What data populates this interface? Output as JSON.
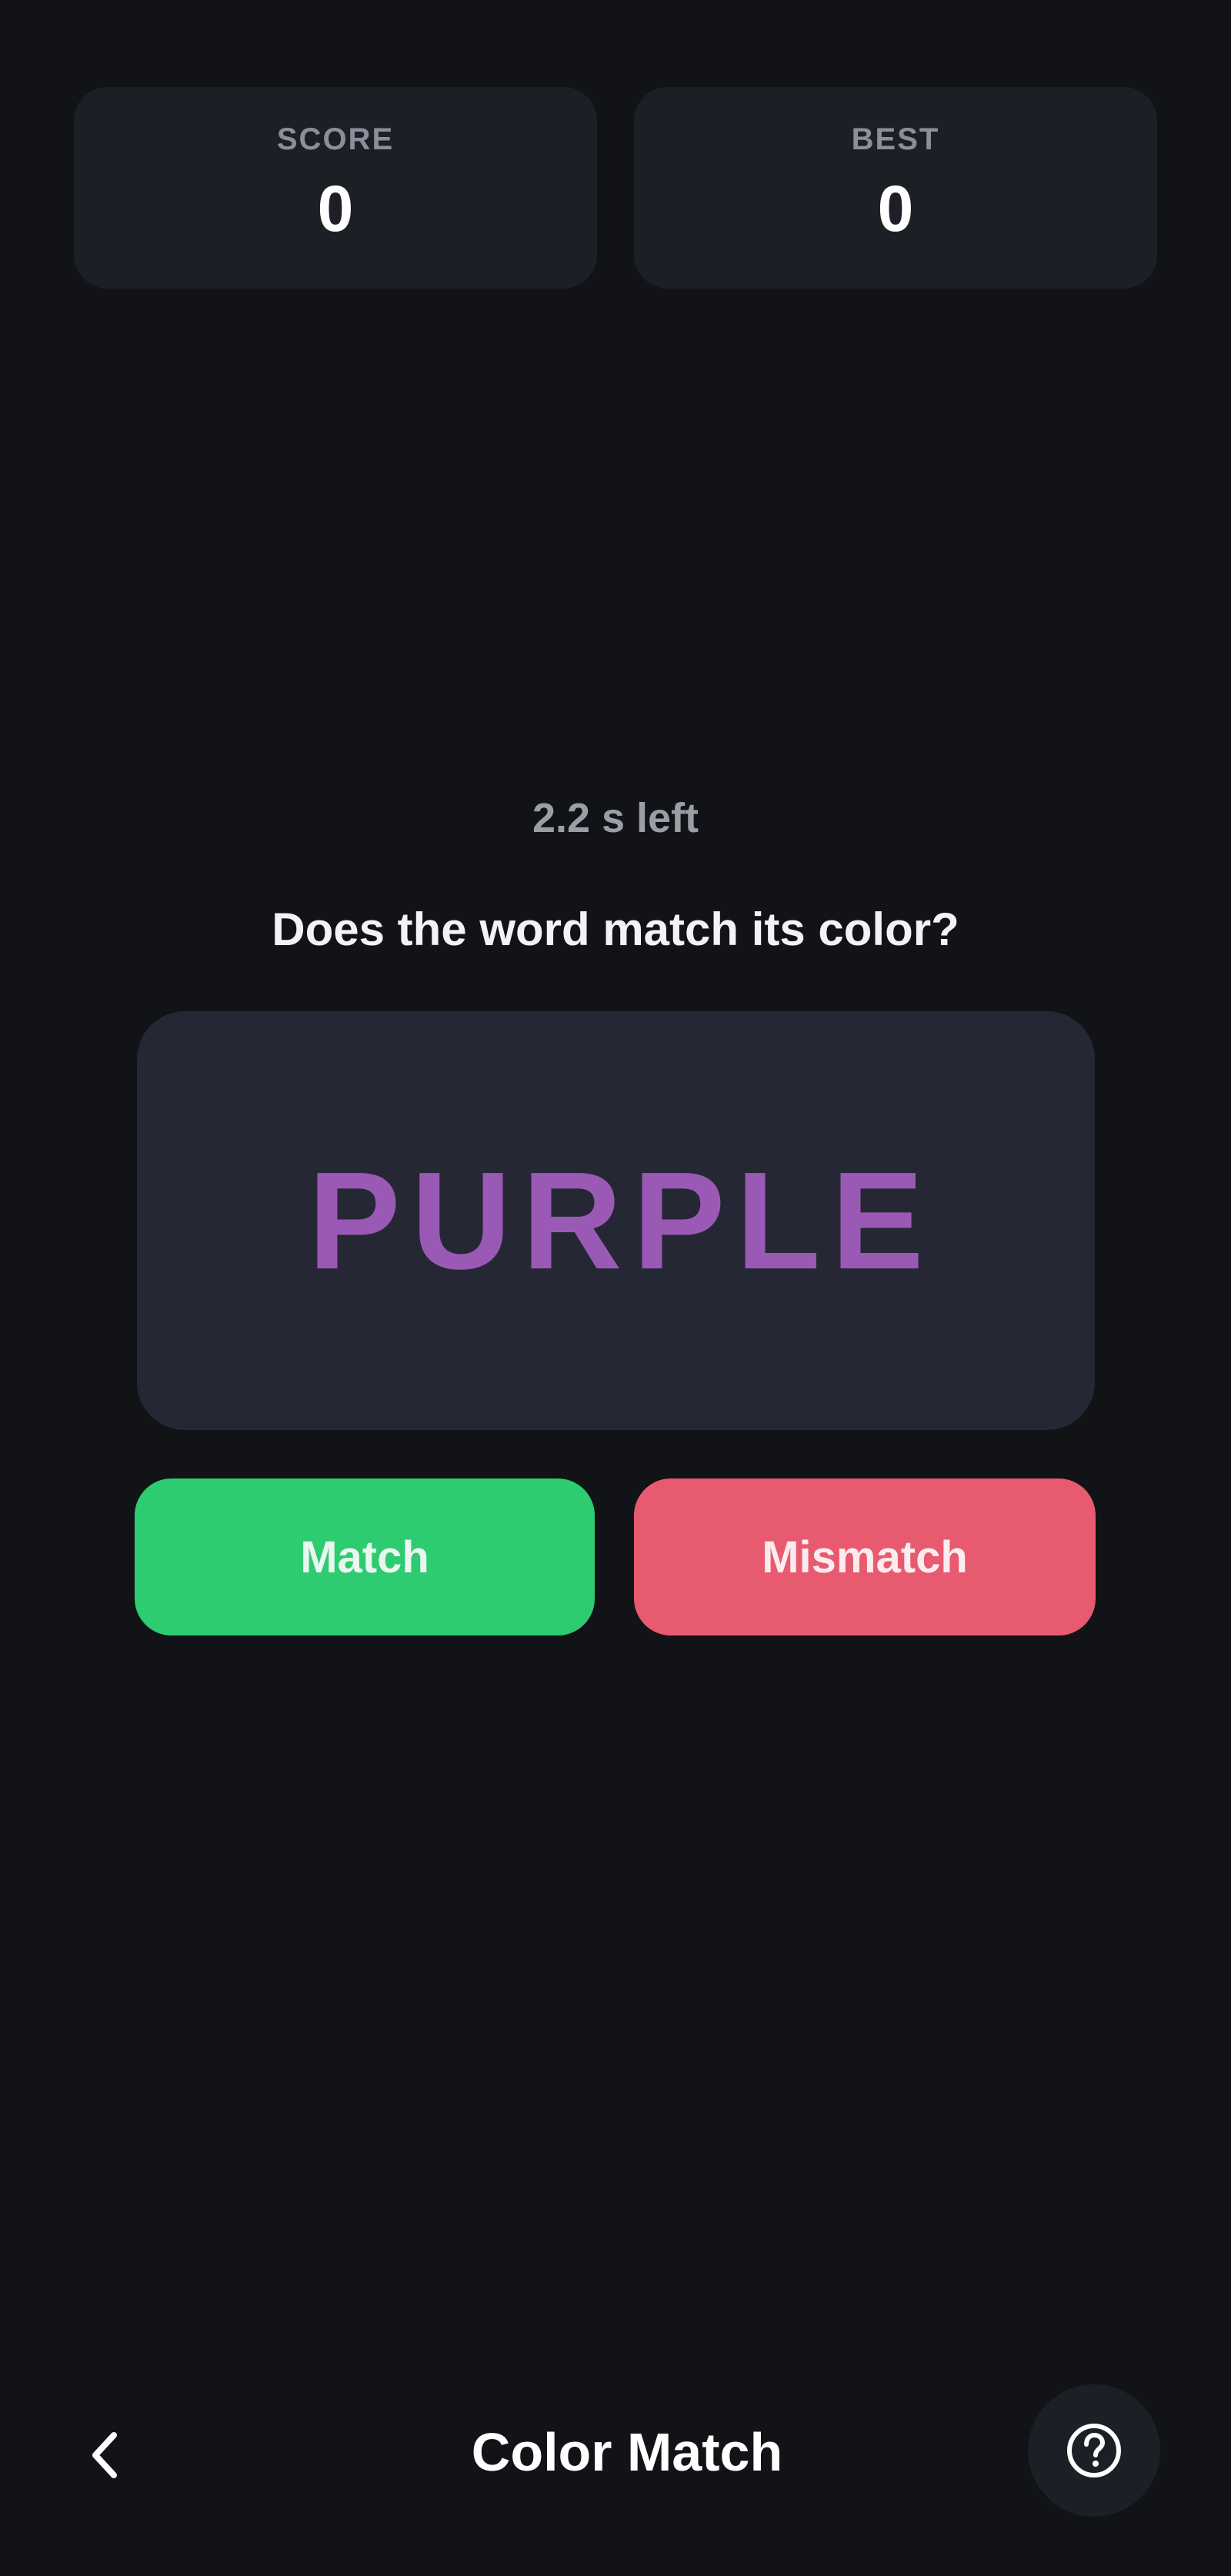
{
  "stats": {
    "score_label": "SCORE",
    "score_value": "0",
    "best_label": "BEST",
    "best_value": "0"
  },
  "game": {
    "timer_text": "2.2 s left",
    "prompt": "Does the word match its color?",
    "word": "PURPLE",
    "word_color": "#9b59b6",
    "match_label": "Match",
    "mismatch_label": "Mismatch"
  },
  "nav": {
    "title": "Color Match",
    "back_icon": "chevron-left-icon",
    "help_icon": "help-circle-icon"
  },
  "colors": {
    "background": "#111317",
    "card": "#1c1f26",
    "word_card": "#252834",
    "match": "#2ecc71",
    "mismatch": "#e85a70"
  }
}
